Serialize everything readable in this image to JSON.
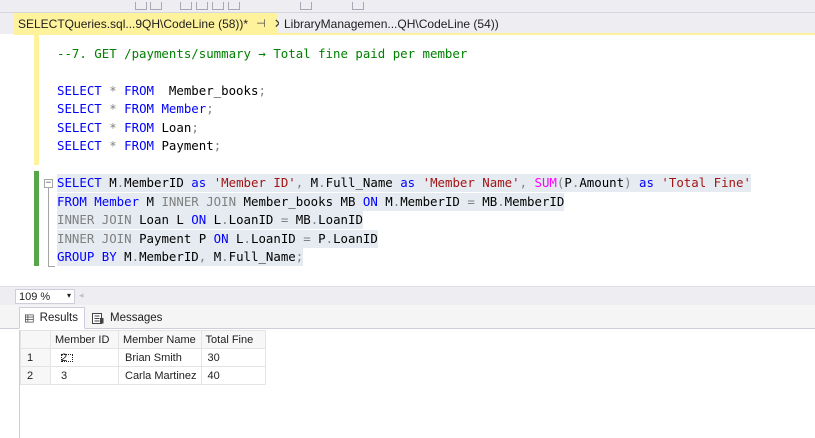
{
  "tabs": [
    {
      "label": "SELECTQueries.sql...9QH\\CodeLine (58))*",
      "pin": "⊣",
      "close": "✕"
    },
    {
      "label": "LibraryManagemen...QH\\CodeLine (54))"
    }
  ],
  "editor": {
    "comment": "--7. GET /payments/summary → Total fine paid per member",
    "fold_glyph": "−",
    "lines": [
      {
        "tokens": [
          [
            "kw",
            "SELECT"
          ],
          [
            "op",
            " * "
          ],
          [
            "kw",
            "FROM"
          ],
          [
            "",
            "  Member_books"
          ],
          [
            "op",
            ";"
          ]
        ]
      },
      {
        "tokens": [
          [
            "kw",
            "SELECT"
          ],
          [
            "op",
            " * "
          ],
          [
            "kw",
            "FROM"
          ],
          [
            "kw",
            " Member"
          ],
          [
            "op",
            ";"
          ]
        ]
      },
      {
        "tokens": [
          [
            "kw",
            "SELECT"
          ],
          [
            "op",
            " * "
          ],
          [
            "kw",
            "FROM"
          ],
          [
            "",
            " Loan"
          ],
          [
            "op",
            ";"
          ]
        ]
      },
      {
        "tokens": [
          [
            "kw",
            "SELECT"
          ],
          [
            "op",
            " * "
          ],
          [
            "kw",
            "FROM"
          ],
          [
            "",
            " Payment"
          ],
          [
            "op",
            ";"
          ]
        ]
      }
    ],
    "query": [
      {
        "tokens": [
          [
            "kw",
            "SELECT"
          ],
          [
            "",
            " M"
          ],
          [
            "op",
            "."
          ],
          [
            "",
            "MemberID "
          ],
          [
            "kw",
            "as"
          ],
          [
            "",
            " "
          ],
          [
            "str",
            "'Member ID'"
          ],
          [
            "op",
            ", "
          ],
          [
            "",
            "M"
          ],
          [
            "op",
            "."
          ],
          [
            "",
            "Full_Name "
          ],
          [
            "kw",
            "as"
          ],
          [
            "",
            " "
          ],
          [
            "str",
            "'Member Name'"
          ],
          [
            "op",
            ", "
          ],
          [
            "fn",
            "SUM"
          ],
          [
            "op",
            "("
          ],
          [
            "",
            "P"
          ],
          [
            "op",
            "."
          ],
          [
            "",
            "Amount"
          ],
          [
            "op",
            ")"
          ],
          [
            "",
            " "
          ],
          [
            "kw",
            "as"
          ],
          [
            "",
            " "
          ],
          [
            "str",
            "'Total Fine'"
          ]
        ]
      },
      {
        "tokens": [
          [
            "kw",
            "FROM"
          ],
          [
            "kw",
            " Member"
          ],
          [
            "",
            " M "
          ],
          [
            "op",
            "INNER JOIN"
          ],
          [
            "",
            " Member_books MB "
          ],
          [
            "kw",
            "ON"
          ],
          [
            "",
            " M"
          ],
          [
            "op",
            "."
          ],
          [
            "",
            "MemberID "
          ],
          [
            "op",
            "="
          ],
          [
            "",
            " MB"
          ],
          [
            "op",
            "."
          ],
          [
            "",
            "MemberID"
          ]
        ]
      },
      {
        "tokens": [
          [
            "op",
            "INNER JOIN"
          ],
          [
            "",
            " Loan L "
          ],
          [
            "kw",
            "ON"
          ],
          [
            "",
            " L"
          ],
          [
            "op",
            "."
          ],
          [
            "",
            "LoanID "
          ],
          [
            "op",
            "="
          ],
          [
            "",
            " MB"
          ],
          [
            "op",
            "."
          ],
          [
            "",
            "LoanID"
          ]
        ]
      },
      {
        "tokens": [
          [
            "op",
            "INNER JOIN"
          ],
          [
            "",
            " Payment P "
          ],
          [
            "kw",
            "ON"
          ],
          [
            "",
            " L"
          ],
          [
            "op",
            "."
          ],
          [
            "",
            "LoanID "
          ],
          [
            "op",
            "="
          ],
          [
            "",
            " P"
          ],
          [
            "op",
            "."
          ],
          [
            "",
            "LoanID"
          ]
        ]
      },
      {
        "tokens": [
          [
            "kw",
            "GROUP BY"
          ],
          [
            "",
            " M"
          ],
          [
            "op",
            "."
          ],
          [
            "",
            "MemberID"
          ],
          [
            "op",
            ", "
          ],
          [
            "",
            "M"
          ],
          [
            "op",
            "."
          ],
          [
            "",
            "Full_Name"
          ],
          [
            "op",
            ";"
          ]
        ]
      }
    ]
  },
  "zoom": {
    "value": "109 %",
    "dropdown_icon": "▾",
    "scroll_icon": "◂"
  },
  "results": {
    "tabs": [
      {
        "label": "Results",
        "icon": "grid-icon"
      },
      {
        "label": "Messages",
        "icon": "messages-icon"
      }
    ],
    "columns": [
      "Member ID",
      "Member Name",
      "Total Fine"
    ],
    "rows": [
      {
        "num": "1",
        "cells": [
          "2",
          "Brian Smith",
          "30"
        ]
      },
      {
        "num": "2",
        "cells": [
          "3",
          "Carla Martinez",
          "40"
        ]
      }
    ]
  },
  "colors": {
    "active_tab": "#fff29d",
    "keyword": "#0000ff",
    "string": "#a31515",
    "function": "#ff00ff",
    "operator": "#808080",
    "comment": "#008000",
    "selection": "#e5ebf1",
    "change_marker_saved": "#57a64a",
    "change_marker_unsaved": "#fff29d"
  }
}
